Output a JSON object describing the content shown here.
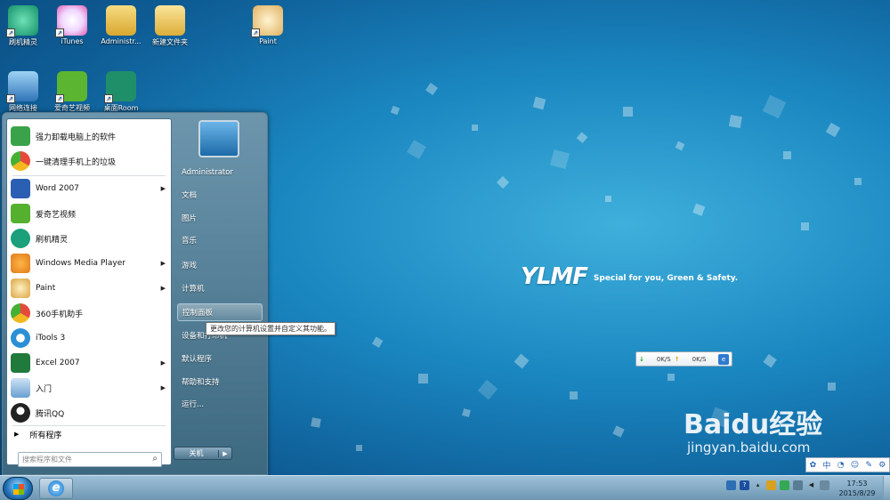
{
  "desktop": {
    "icons": [
      {
        "label": "刷机精灵",
        "icon": "shuaji-icon"
      },
      {
        "label": "iTunes",
        "icon": "itunes-icon"
      },
      {
        "label": "Administr...",
        "icon": "user-folder-icon"
      },
      {
        "label": "新建文件夹",
        "icon": "folder-icon"
      },
      {
        "label": "Paint",
        "icon": "paint-icon"
      },
      {
        "label": "网络连接",
        "icon": "network-icon"
      },
      {
        "label": "爱奇艺视频",
        "icon": "iqiyi-icon"
      },
      {
        "label": "桌面Room",
        "icon": "r-app-icon"
      }
    ],
    "brand_logo": "YLMF",
    "brand_tagline": "Special for you, Green & Safety."
  },
  "start_menu": {
    "programs": [
      {
        "label": "强力卸载电脑上的软件",
        "icon": "uninstall-icon",
        "color": "#3aa34a",
        "submenu": false
      },
      {
        "label": "一键清理手机上的垃圾",
        "icon": "cleaner-icon",
        "color": "#e8a020",
        "submenu": false
      },
      {
        "label": "Word 2007",
        "icon": "word-icon",
        "color": "#2b5fb4",
        "submenu": true
      },
      {
        "label": "爱奇艺视频",
        "icon": "iqiyi-icon",
        "color": "#56b02f",
        "submenu": false
      },
      {
        "label": "刷机精灵",
        "icon": "shuaji-icon",
        "color": "#1aa07a",
        "submenu": false
      },
      {
        "label": "Windows Media Player",
        "icon": "media-player-icon",
        "color": "#e07a18",
        "submenu": true
      },
      {
        "label": "Paint",
        "icon": "paint-icon",
        "color": "#d9a441",
        "submenu": true
      },
      {
        "label": "360手机助手",
        "icon": "360-icon",
        "color": "#46b035",
        "submenu": false
      },
      {
        "label": "iTools 3",
        "icon": "itools-icon",
        "color": "#2b8fd6",
        "submenu": false
      },
      {
        "label": "Excel 2007",
        "icon": "excel-icon",
        "color": "#1f7a3c",
        "submenu": true
      },
      {
        "label": "入门",
        "icon": "getting-started-icon",
        "color": "#6a9fd0",
        "submenu": true
      },
      {
        "label": "腾讯QQ",
        "icon": "qq-icon",
        "color": "#222222",
        "submenu": false
      }
    ],
    "all_programs": "所有程序",
    "search_placeholder": "搜索程序和文件",
    "right_items": [
      "Administrator",
      "文档",
      "图片",
      "音乐",
      "游戏",
      "计算机",
      "控制面板",
      "设备和打印机",
      "默认程序",
      "帮助和支持",
      "运行..."
    ],
    "highlighted": "控制面板",
    "tooltip": "更改您的计算机设置并自定义其功能。",
    "shutdown": "关机"
  },
  "net_widget": {
    "down": "0K/S",
    "up": "0K/S"
  },
  "watermark": {
    "brand": "Baidu经验",
    "url": "jingyan.baidu.com"
  },
  "ime_bar": {
    "label": "中"
  },
  "taskbar": {
    "time": "17:53",
    "date": "2015/8/29"
  }
}
